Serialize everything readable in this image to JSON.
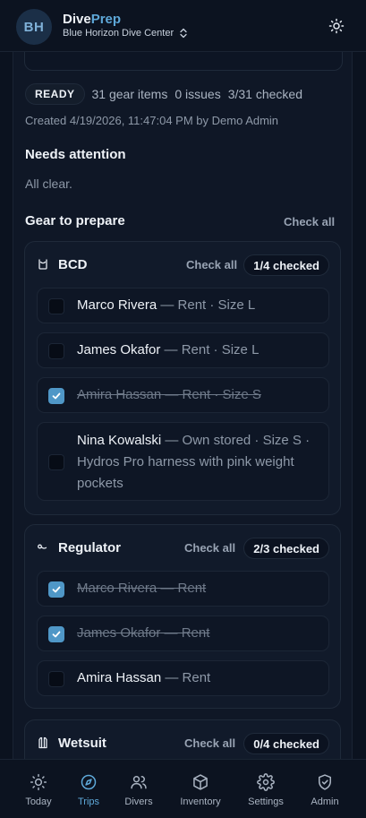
{
  "header": {
    "avatar_initials": "BH",
    "brand_part1": "Dive",
    "brand_part2": "Prep",
    "org_name": "Blue Horizon Dive Center"
  },
  "status": {
    "badge": "READY",
    "gear_items": "31 gear items",
    "issues": "0 issues",
    "checked": "3/31 checked",
    "created": "Created 4/19/2026, 11:47:04 PM by Demo Admin"
  },
  "attention": {
    "title": "Needs attention",
    "message": "All clear."
  },
  "gear": {
    "title": "Gear to prepare",
    "check_all": "Check all",
    "groups": [
      {
        "name": "BCD",
        "check_all": "Check all",
        "progress": "1/4 checked",
        "items": [
          {
            "name": "Marco Rivera",
            "detail": " — Rent · Size L",
            "checked": false
          },
          {
            "name": "James Okafor",
            "detail": " — Rent · Size L",
            "checked": false
          },
          {
            "name": "Amira Hassan",
            "detail": " — Rent · Size S",
            "checked": true
          },
          {
            "name": "Nina Kowalski",
            "detail": " — Own stored · Size S · Hydros Pro harness with pink weight pockets",
            "checked": false
          }
        ]
      },
      {
        "name": "Regulator",
        "check_all": "Check all",
        "progress": "2/3 checked",
        "items": [
          {
            "name": "Marco Rivera",
            "detail": " — Rent",
            "checked": true
          },
          {
            "name": "James Okafor",
            "detail": " — Rent",
            "checked": true
          },
          {
            "name": "Amira Hassan",
            "detail": " — Rent",
            "checked": false
          }
        ]
      },
      {
        "name": "Wetsuit",
        "check_all": "Check all",
        "progress": "0/4 checked",
        "items": []
      }
    ]
  },
  "nav": {
    "items": [
      {
        "label": "Today",
        "icon": "sun-icon"
      },
      {
        "label": "Trips",
        "icon": "compass-icon",
        "active": true
      },
      {
        "label": "Divers",
        "icon": "users-icon"
      },
      {
        "label": "Inventory",
        "icon": "box-icon"
      },
      {
        "label": "Settings",
        "icon": "gear-icon"
      },
      {
        "label": "Admin",
        "icon": "shield-icon"
      }
    ]
  },
  "colors": {
    "background": "#0b121f",
    "accent": "#5ea8d8",
    "checkbox_checked": "#4f97c7"
  }
}
